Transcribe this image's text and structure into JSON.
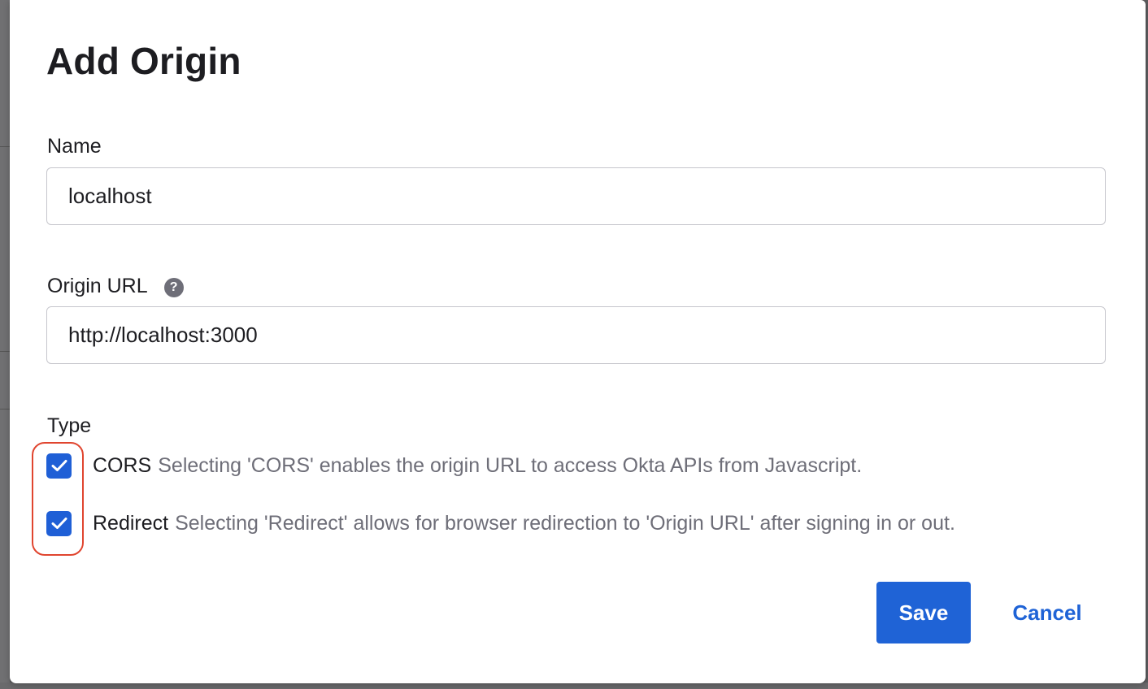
{
  "dialog": {
    "title": "Add Origin",
    "name_label": "Name",
    "name_value": "localhost",
    "origin_url_label": "Origin URL",
    "origin_url_help": "?",
    "origin_url_value": "http://localhost:3000",
    "type_label": "Type",
    "types": [
      {
        "name": "CORS",
        "checked": true,
        "description": "Selecting 'CORS' enables the origin URL to access Okta APIs from Javascript."
      },
      {
        "name": "Redirect",
        "checked": true,
        "description": "Selecting 'Redirect' allows for browser redirection to 'Origin URL' after signing in or out."
      }
    ],
    "save_label": "Save",
    "cancel_label": "Cancel"
  },
  "colors": {
    "accent": "#1f63d6",
    "checkbox": "#1f5fd6",
    "highlight": "#e0452f",
    "text": "#1d1d21",
    "muted_text": "#6e6e78",
    "overlay": "#5c5c5e"
  },
  "icons": {
    "help": "question-circle-icon",
    "check": "checkmark-icon"
  }
}
